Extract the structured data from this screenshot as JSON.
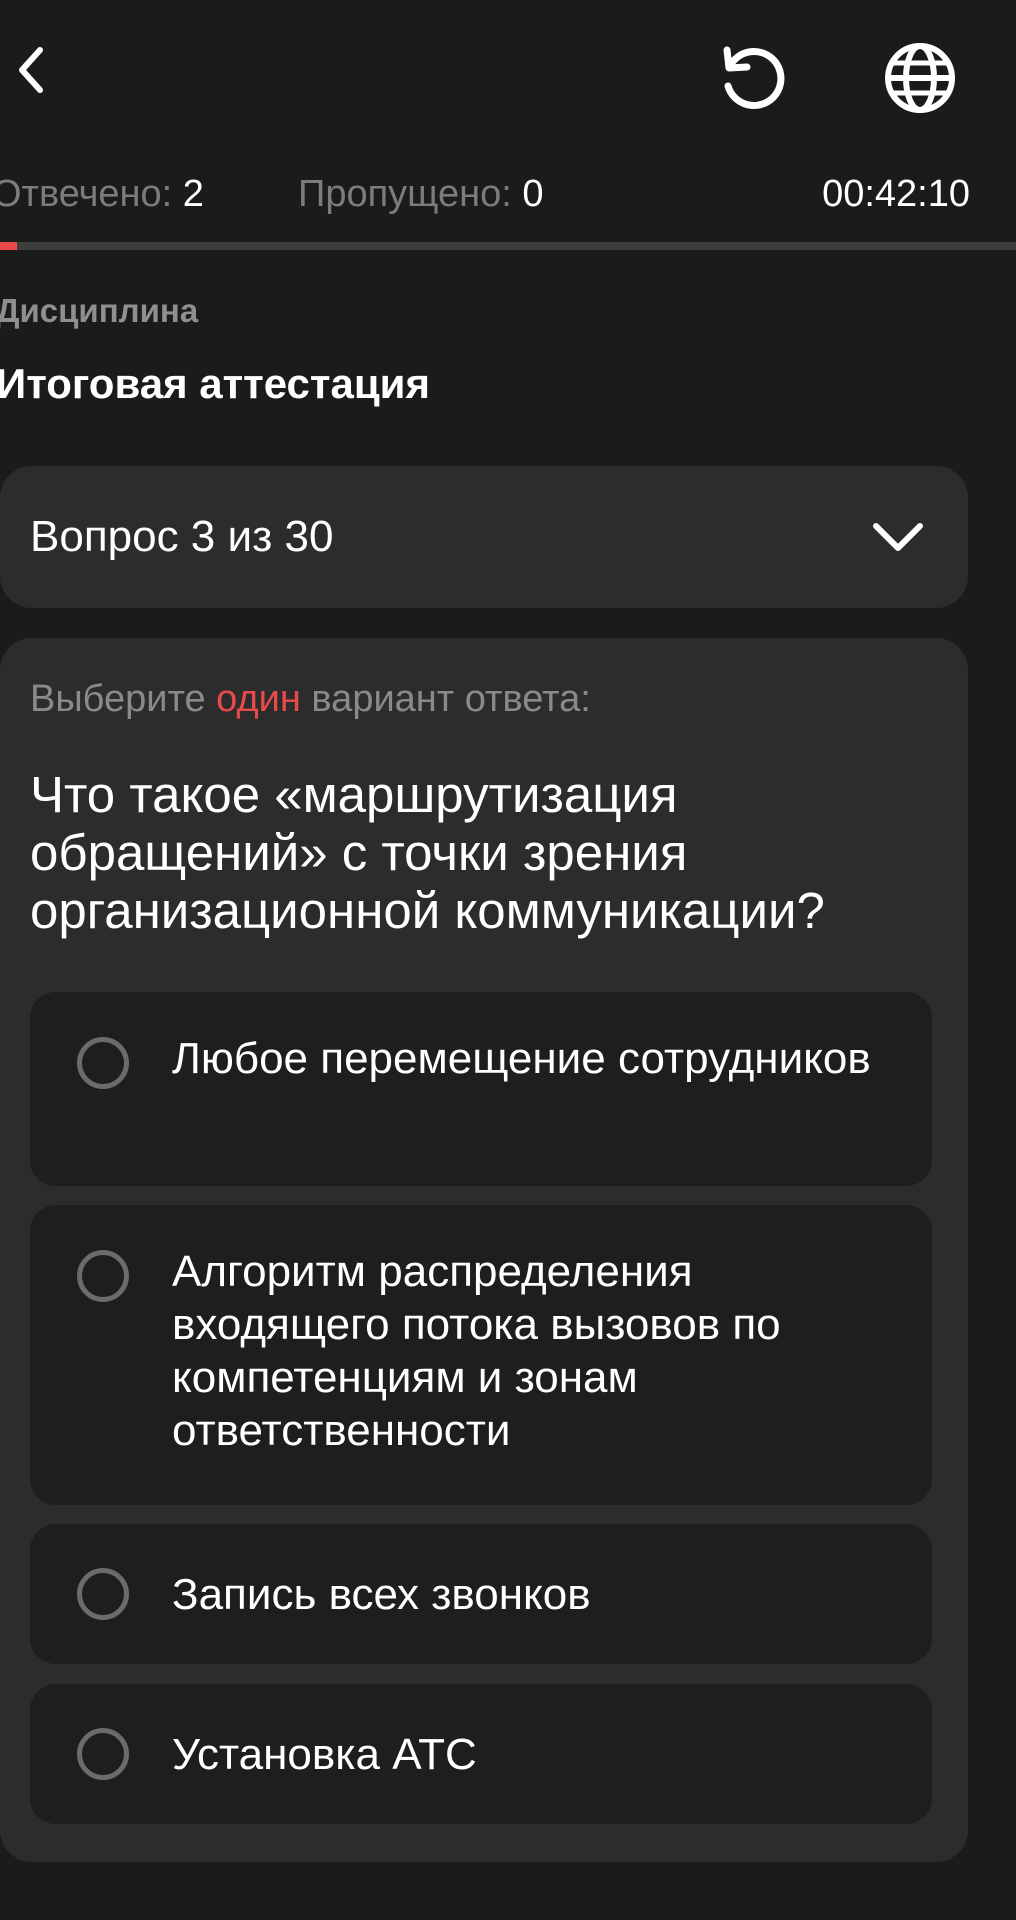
{
  "header": {
    "icons": {
      "back": "chevron-left-icon",
      "reload": "reload-icon",
      "language": "globe-icon"
    }
  },
  "stats": {
    "answered_label": "Отвечено:",
    "answered_value": "2",
    "skipped_label": "Пропущено:",
    "skipped_value": "0",
    "timer": "00:42:10"
  },
  "progress": {
    "fraction": 0.0167
  },
  "discipline": {
    "label": "Дисциплина",
    "title": "Итоговая аттестация"
  },
  "question_selector": {
    "label": "Вопрос 3 из 30",
    "icon": "chevron-down-icon"
  },
  "question": {
    "instruction_prefix": "Выберите",
    "instruction_accent": "один",
    "instruction_suffix": "вариант ответа:",
    "text": "Что такое «маршрутизация обращений» с точки зрения организационной коммуникации?",
    "options": [
      {
        "label": "Любое перемещение сотрудников",
        "selected": false
      },
      {
        "label": "Алгоритм распределения входящего потока вызовов по компетенциям и зонам ответственности",
        "selected": false
      },
      {
        "label": "Запись всех звонков",
        "selected": false
      },
      {
        "label": "Установка АТС",
        "selected": false
      }
    ]
  },
  "colors": {
    "background": "#1b1b1b",
    "card": "#2c2c2c",
    "option": "#1e1e1e",
    "accent": "#e84a4a",
    "muted_text": "#7c7c7c"
  }
}
